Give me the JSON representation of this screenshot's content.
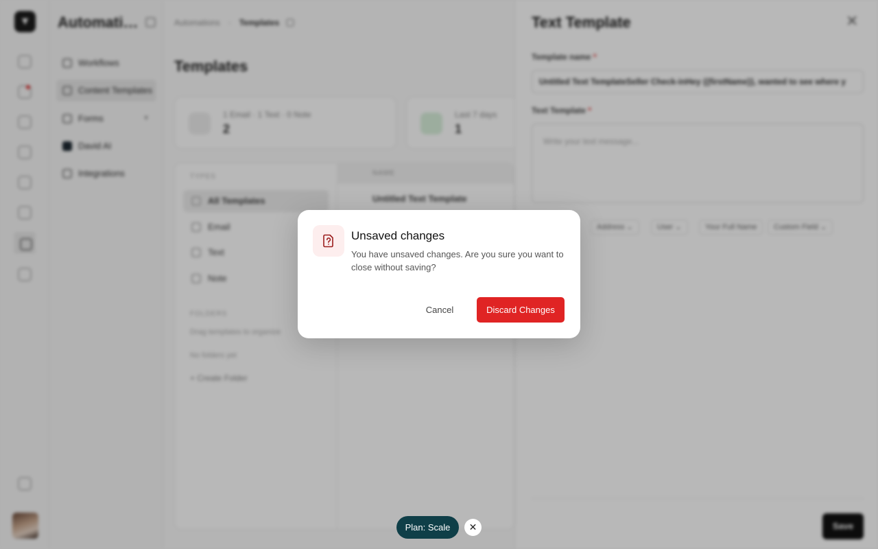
{
  "rail": {
    "logo": "▼"
  },
  "sidebar": {
    "title": "Automations",
    "items": [
      {
        "label": "Workflows"
      },
      {
        "label": "Content Templates"
      },
      {
        "label": "Forms"
      },
      {
        "label": "David AI"
      },
      {
        "label": "Integrations"
      }
    ]
  },
  "breadcrumb": {
    "parent": "Automations",
    "current": "Templates"
  },
  "main": {
    "title": "Templates",
    "stats": [
      {
        "label": "1 Email · 1 Text · 0 Note",
        "value": "2"
      },
      {
        "label": "Last 7 days",
        "value": "1"
      }
    ],
    "types_header": "TYPES",
    "types": [
      {
        "label": "All Templates"
      },
      {
        "label": "Email"
      },
      {
        "label": "Text"
      },
      {
        "label": "Note"
      }
    ],
    "folders_header": "FOLDERS",
    "folders_hint": "Drag templates to organize",
    "folders_hint2": "No folders yet",
    "create_folder": "+ Create Folder",
    "table_header": "NAME",
    "rows": [
      {
        "name": "Untitled Text Template"
      }
    ]
  },
  "drawer": {
    "title": "Text Template",
    "close": "✕",
    "name_label": "Template name",
    "name_value": "Untitled Text TemplateSeller Check-inHey {{firstName}}, wanted to see where y",
    "text_label": "Text Template",
    "text_placeholder": "Write your text message...",
    "required_mark": "*",
    "chips": [
      {
        "label": "Address"
      },
      {
        "label": "User"
      },
      {
        "label": "Your Full Name"
      },
      {
        "label": "Custom Field"
      }
    ],
    "save_label": "Save"
  },
  "modal": {
    "title": "Unsaved changes",
    "message": "You have unsaved changes. Are you sure you want to close without saving?",
    "cancel_label": "Cancel",
    "discard_label": "Discard Changes",
    "icon": "file-question-icon",
    "accent_color": "#e02424",
    "icon_color": "#9b1c1c"
  },
  "plan_badge": {
    "label": "Plan: Scale",
    "close": "✕",
    "color": "#0f3f48"
  }
}
